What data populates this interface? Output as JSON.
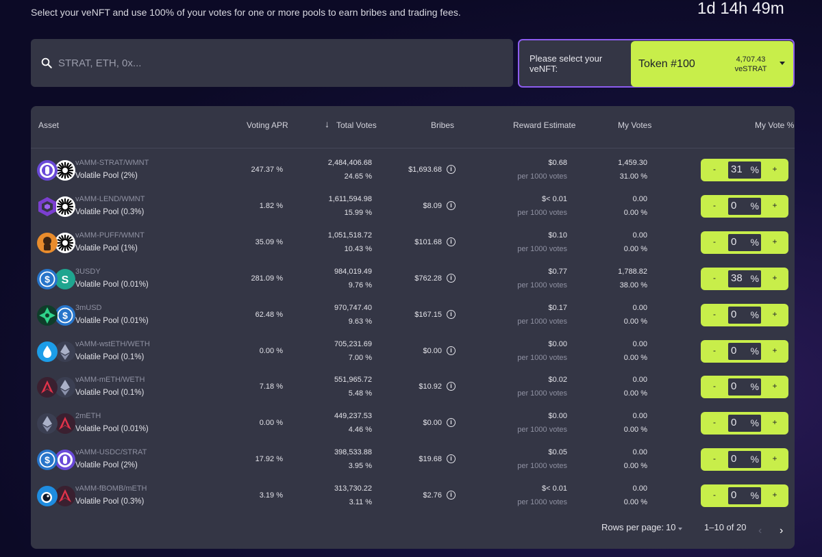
{
  "header": {
    "subtitle": "Select your veNFT and use 100% of your votes for one or more pools to earn bribes and trading fees.",
    "countdown": "1d 14h 49m"
  },
  "search": {
    "placeholder": "STRAT, ETH, 0x..."
  },
  "nft": {
    "label": "Please select your veNFT:",
    "token": "Token #100",
    "amount": "4,707.43",
    "unit": "veSTRAT"
  },
  "columns": {
    "asset": "Asset",
    "voting_apr": "Voting APR",
    "total_votes": "Total Votes",
    "bribes": "Bribes",
    "reward": "Reward Estimate",
    "my_votes": "My Votes",
    "my_vote_pct": "My Vote %"
  },
  "rows": [
    {
      "name": "vAMM-STRAT/WMNT",
      "type": "Volatile Pool (2%)",
      "apr": "247.37 %",
      "votes": "2,484,406.68",
      "votes_pct": "24.65 %",
      "bribes": "$1,693.68",
      "reward": "$0.68",
      "reward_sub": "per 1000 votes",
      "my_votes": "1,459.30",
      "my_votes_pct": "31.00 %",
      "vote": "31",
      "icons": [
        "strat-icon",
        "wmnt-icon"
      ]
    },
    {
      "name": "vAMM-LEND/WMNT",
      "type": "Volatile Pool (0.3%)",
      "apr": "1.82 %",
      "votes": "1,611,594.98",
      "votes_pct": "15.99 %",
      "bribes": "$8.09",
      "reward": "$< 0.01",
      "reward_sub": "per 1000 votes",
      "my_votes": "0.00",
      "my_votes_pct": "0.00 %",
      "vote": "0",
      "icons": [
        "lend-icon",
        "wmnt-icon"
      ]
    },
    {
      "name": "vAMM-PUFF/WMNT",
      "type": "Volatile Pool (1%)",
      "apr": "35.09 %",
      "votes": "1,051,518.72",
      "votes_pct": "10.43 %",
      "bribes": "$101.68",
      "reward": "$0.10",
      "reward_sub": "per 1000 votes",
      "my_votes": "0.00",
      "my_votes_pct": "0.00 %",
      "vote": "0",
      "icons": [
        "puff-icon",
        "wmnt-icon"
      ]
    },
    {
      "name": "3USDY",
      "type": "Volatile Pool (0.01%)",
      "apr": "281.09 %",
      "votes": "984,019.49",
      "votes_pct": "9.76 %",
      "bribes": "$762.28",
      "reward": "$0.77",
      "reward_sub": "per 1000 votes",
      "my_votes": "1,788.82",
      "my_votes_pct": "38.00 %",
      "vote": "38",
      "icons": [
        "usdc-icon",
        "usdy-icon"
      ]
    },
    {
      "name": "3mUSD",
      "type": "Volatile Pool (0.01%)",
      "apr": "62.48 %",
      "votes": "970,747.40",
      "votes_pct": "9.63 %",
      "bribes": "$167.15",
      "reward": "$0.17",
      "reward_sub": "per 1000 votes",
      "my_votes": "0.00",
      "my_votes_pct": "0.00 %",
      "vote": "0",
      "icons": [
        "musd-icon",
        "usdc-icon"
      ]
    },
    {
      "name": "vAMM-wstETH/WETH",
      "type": "Volatile Pool (0.1%)",
      "apr": "0.00 %",
      "votes": "705,231.69",
      "votes_pct": "7.00 %",
      "bribes": "$0.00",
      "reward": "$0.00",
      "reward_sub": "per 1000 votes",
      "my_votes": "0.00",
      "my_votes_pct": "0.00 %",
      "vote": "0",
      "icons": [
        "wsteth-icon",
        "eth-icon"
      ]
    },
    {
      "name": "vAMM-mETH/WETH",
      "type": "Volatile Pool (0.1%)",
      "apr": "7.18 %",
      "votes": "551,965.72",
      "votes_pct": "5.48 %",
      "bribes": "$10.92",
      "reward": "$0.02",
      "reward_sub": "per 1000 votes",
      "my_votes": "0.00",
      "my_votes_pct": "0.00 %",
      "vote": "0",
      "icons": [
        "meth-icon",
        "eth-icon"
      ]
    },
    {
      "name": "2mETH",
      "type": "Volatile Pool (0.01%)",
      "apr": "0.00 %",
      "votes": "449,237.53",
      "votes_pct": "4.46 %",
      "bribes": "$0.00",
      "reward": "$0.00",
      "reward_sub": "per 1000 votes",
      "my_votes": "0.00",
      "my_votes_pct": "0.00 %",
      "vote": "0",
      "icons": [
        "eth-icon",
        "meth-icon"
      ]
    },
    {
      "name": "vAMM-USDC/STRAT",
      "type": "Volatile Pool (2%)",
      "apr": "17.92 %",
      "votes": "398,533.88",
      "votes_pct": "3.95 %",
      "bribes": "$19.68",
      "reward": "$0.05",
      "reward_sub": "per 1000 votes",
      "my_votes": "0.00",
      "my_votes_pct": "0.00 %",
      "vote": "0",
      "icons": [
        "usdc-icon",
        "strat-icon"
      ]
    },
    {
      "name": "vAMM-fBOMB/mETH",
      "type": "Volatile Pool (0.3%)",
      "apr": "3.19 %",
      "votes": "313,730.22",
      "votes_pct": "3.11 %",
      "bribes": "$2.76",
      "reward": "$< 0.01",
      "reward_sub": "per 1000 votes",
      "my_votes": "0.00",
      "my_votes_pct": "0.00 %",
      "vote": "0",
      "icons": [
        "fbomb-icon",
        "meth-icon"
      ]
    }
  ],
  "vote_controls": {
    "minus": "-",
    "plus": "+",
    "pct": "%"
  },
  "pagination": {
    "rows_label": "Rows per page:",
    "rows_value": "10",
    "range": "1–10 of 20"
  },
  "colors": {
    "accent": "#c8ee4a",
    "border_accent": "#8d5cf0",
    "card": "#343645"
  }
}
